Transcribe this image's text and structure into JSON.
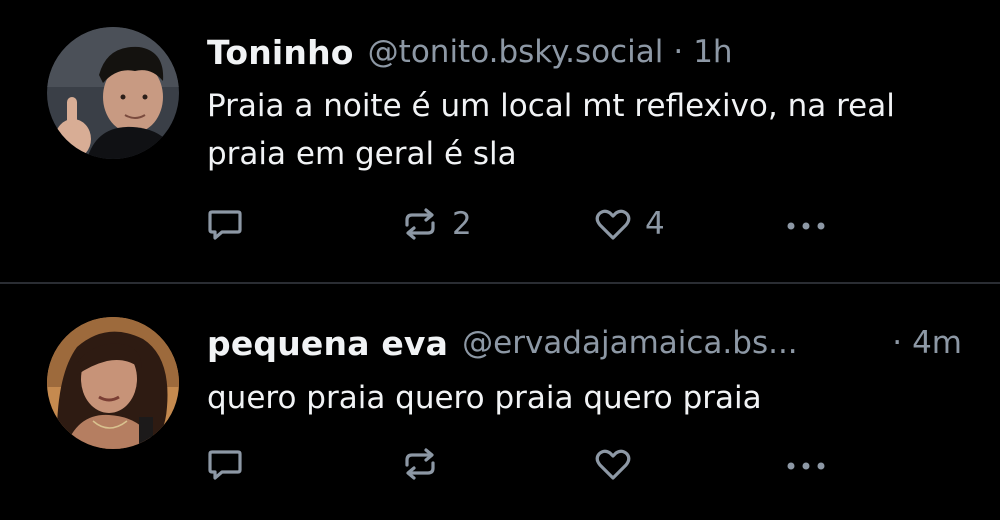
{
  "colors": {
    "background": "#000000",
    "text": "#f1f3f5",
    "muted": "#8d98a5",
    "divider": "#2a2d33"
  },
  "posts": [
    {
      "author": "Toninho",
      "handle": "@tonito.bsky.social",
      "separator": "·",
      "time": "1h",
      "text": "Praia a noite é um local mt reflexivo, na real praia em geral é sla",
      "reply_count": "",
      "repost_count": "2",
      "like_count": "4",
      "icons": [
        "reply-icon",
        "repost-icon",
        "like-icon",
        "more-icon"
      ]
    },
    {
      "author": "pequena eva",
      "handle": "@ervadajamaica.bs...",
      "separator": "·",
      "time": "4m",
      "text": "quero praia quero praia quero praia",
      "reply_count": "",
      "repost_count": "",
      "like_count": "",
      "icons": [
        "reply-icon",
        "repost-icon",
        "like-icon",
        "more-icon"
      ]
    }
  ]
}
